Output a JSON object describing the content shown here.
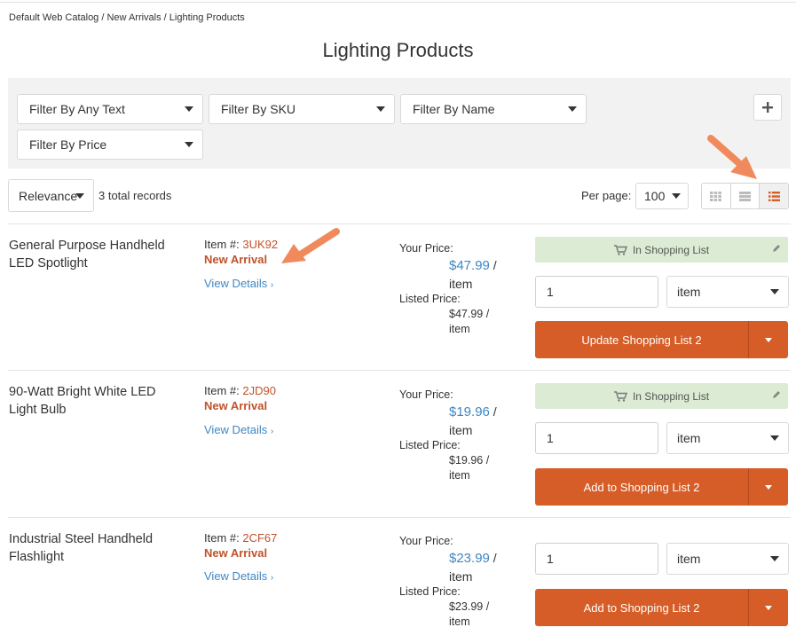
{
  "breadcrumb": [
    "Default Web Catalog",
    "New Arrivals",
    "Lighting Products"
  ],
  "breadcrumb_sep": " / ",
  "page_title": "Lighting Products",
  "filters": {
    "any_text": "Filter By Any Text",
    "sku": "Filter By SKU",
    "name": "Filter By Name",
    "price": "Filter By Price",
    "add_icon": "plus-icon"
  },
  "toolbar": {
    "sort": "Relevance",
    "records": "3 total records",
    "per_page_label": "Per page:",
    "per_page_value": "100",
    "view_modes": [
      "grid-view-icon",
      "list-view-icon",
      "table-view-icon"
    ],
    "active_view": "table-view-icon"
  },
  "products": [
    {
      "name": "General Purpose Handheld LED Spotlight",
      "item_label": "Item #:",
      "sku": "3UK92",
      "badge": "New Arrival",
      "details": "View Details",
      "your_price_label": "Your Price:",
      "your_price": "$47.99",
      "your_price_unit": "/ item",
      "listed_label": "Listed Price:",
      "listed_price": "$47.99 / item",
      "in_list": "In Shopping List",
      "qty": "1",
      "unit": "item",
      "button": "Update Shopping List 2"
    },
    {
      "name": "90-Watt Bright White LED Light Bulb",
      "item_label": "Item #:",
      "sku": "2JD90",
      "badge": "New Arrival",
      "details": "View Details",
      "your_price_label": "Your Price:",
      "your_price": "$19.96",
      "your_price_unit": "/ item",
      "listed_label": "Listed Price:",
      "listed_price": "$19.96 / item",
      "in_list": "In Shopping List",
      "qty": "1",
      "unit": "item",
      "button": "Add to Shopping List 2"
    },
    {
      "name": "Industrial Steel Handheld Flashlight",
      "item_label": "Item #:",
      "sku": "2CF67",
      "badge": "New Arrival",
      "details": "View Details",
      "your_price_label": "Your Price:",
      "your_price": "$23.99",
      "your_price_unit": "/ item",
      "listed_label": "Listed Price:",
      "listed_price": "$23.99 / item",
      "qty": "1",
      "unit": "item",
      "button": "Add to Shopping List 2"
    }
  ],
  "colors": {
    "accent_orange": "#d65d27",
    "link_blue": "#3f87c3",
    "badge_red": "#c0522a",
    "in_list_green": "#dcecd4",
    "annotation_arrow": "#f08a5d"
  }
}
